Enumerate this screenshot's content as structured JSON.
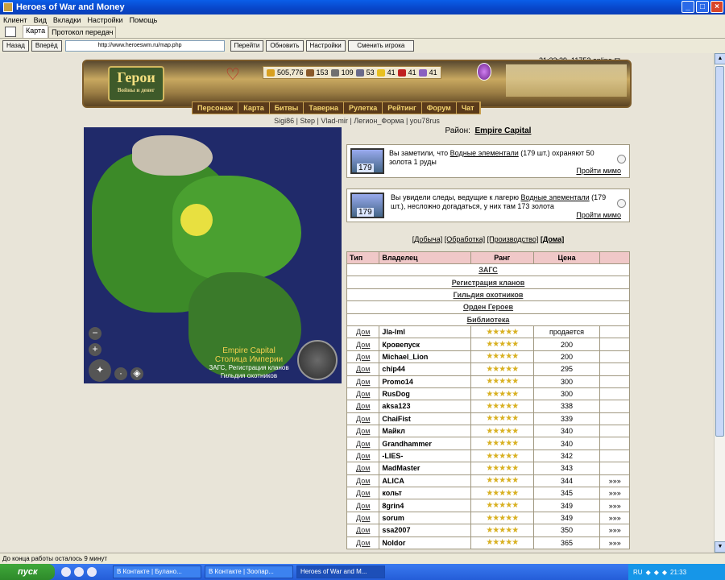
{
  "window": {
    "title": "Heroes of War and Money",
    "min": "_",
    "max": "□",
    "close": "×"
  },
  "menu": [
    "Клиент",
    "Вид",
    "Вкладки",
    "Настройки",
    "Помощь"
  ],
  "tabs": [
    "Карта",
    "Протокол передач"
  ],
  "nav": {
    "back": "Назад",
    "forward": "Вперёд",
    "url": "http://www.heroeswm.ru/map.php",
    "go": "Перейти",
    "refresh": "Обновить",
    "settings": "Настройки",
    "switch": "Сменить игрока"
  },
  "header": {
    "clock": "21:33:39, 11752 online",
    "logo": "Герои",
    "logo_sub": "Войны и денег",
    "resources": [
      "505,776",
      "153",
      "109",
      "53",
      "41",
      "41",
      "41"
    ],
    "resource_colors": [
      "#d8a020",
      "#8a5a2a",
      "#707070",
      "#6a6a8a",
      "#e8c020",
      "#c02020",
      "#8a60c0"
    ],
    "menu": [
      "Персонаж",
      "Карта",
      "Битвы",
      "Таверна",
      "Рулетка",
      "Рейтинг",
      "Форум",
      "Чат"
    ]
  },
  "sublinks": "Sigi86 | Step | Vlad-mir | Легион_Форма | you78rus",
  "map": {
    "label1": "Empire Capital",
    "label2": "Столица Империи",
    "label3": "ЗАГС, Регистрация кланов",
    "label4": "Гильдия охотников"
  },
  "district": {
    "prefix": "Район:",
    "name": "Empire Capital"
  },
  "events": [
    {
      "count": "179",
      "pre": "Вы заметили, что ",
      "link": "Водные элементали",
      "post": " (179 шт.) охраняют 50 золота 1 руды",
      "action": "Пройти мимо"
    },
    {
      "count": "179",
      "pre": "Вы увидели следы, ведущие к лагерю ",
      "link": "Водные элементали",
      "post": " (179 шт.), несложно догадаться, у них там 173 золота",
      "action": "Пройти мимо"
    }
  ],
  "categories": [
    "[Добыча]",
    "[Обработка]",
    "[Производство]",
    "[Дома]"
  ],
  "table": {
    "headers": [
      "Тип",
      "Владелец",
      "Ранг",
      "Цена",
      ""
    ],
    "buildings": [
      "ЗАГС",
      "Регистрация кланов",
      "Гильдия охотников",
      "Орден Героев",
      "Библиотека"
    ],
    "rows": [
      {
        "type": "Дом",
        "owner": "Jla-lml",
        "price": "продается",
        "extra": ""
      },
      {
        "type": "Дом",
        "owner": "Кровепуск",
        "price": "200",
        "extra": ""
      },
      {
        "type": "Дом",
        "owner": "Michael_Lion",
        "price": "200",
        "extra": ""
      },
      {
        "type": "Дом",
        "owner": "chip44",
        "price": "295",
        "extra": ""
      },
      {
        "type": "Дом",
        "owner": "Promo14",
        "price": "300",
        "extra": ""
      },
      {
        "type": "Дом",
        "owner": "RusDog",
        "price": "300",
        "extra": ""
      },
      {
        "type": "Дом",
        "owner": "aksa123",
        "price": "338",
        "extra": ""
      },
      {
        "type": "Дом",
        "owner": "ChaiFist",
        "price": "339",
        "extra": ""
      },
      {
        "type": "Дом",
        "owner": "Майкл",
        "price": "340",
        "extra": ""
      },
      {
        "type": "Дом",
        "owner": "Grandhammer",
        "price": "340",
        "extra": ""
      },
      {
        "type": "Дом",
        "owner": "-LIES-",
        "price": "342",
        "extra": ""
      },
      {
        "type": "Дом",
        "owner": "MadMaster",
        "price": "343",
        "extra": ""
      },
      {
        "type": "Дом",
        "owner": "ALICA",
        "price": "344",
        "extra": "»»»"
      },
      {
        "type": "Дом",
        "owner": "кольт",
        "price": "345",
        "extra": "»»»"
      },
      {
        "type": "Дом",
        "owner": "8grin4",
        "price": "349",
        "extra": "»»»"
      },
      {
        "type": "Дом",
        "owner": "sorum",
        "price": "349",
        "extra": "»»»"
      },
      {
        "type": "Дом",
        "owner": "ssa2007",
        "price": "350",
        "extra": "»»»"
      },
      {
        "type": "Дом",
        "owner": "Noldor",
        "price": "365",
        "extra": "»»»"
      }
    ],
    "stars": "★★★★★"
  },
  "status": "До конца работы осталось 9 минут",
  "taskbar": {
    "start": "пуск",
    "tasks": [
      "В Контакте | Булано...",
      "В Контакте | Зоопар...",
      "Heroes of War and M..."
    ],
    "lang": "RU",
    "time": "21:33"
  }
}
